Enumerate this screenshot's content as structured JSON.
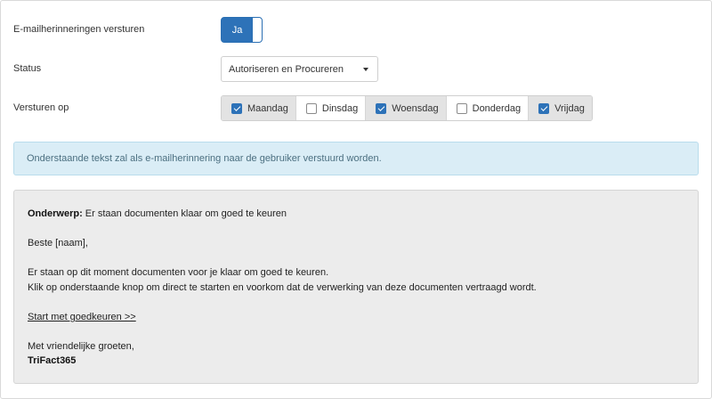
{
  "settings": {
    "reminders_label": "E-mailherinneringen versturen",
    "toggle_value": "Ja",
    "status_label": "Status",
    "status_selected": "Autoriseren en Procureren",
    "send_on_label": "Versturen op",
    "days": [
      {
        "label": "Maandag",
        "checked": true
      },
      {
        "label": "Dinsdag",
        "checked": false
      },
      {
        "label": "Woensdag",
        "checked": true
      },
      {
        "label": "Donderdag",
        "checked": false
      },
      {
        "label": "Vrijdag",
        "checked": true
      }
    ]
  },
  "info": {
    "text": "Onderstaande tekst zal als e-mailherinnering naar de gebruiker verstuurd worden."
  },
  "email": {
    "subject_label": "Onderwerp:",
    "subject": "Er staan documenten klaar om goed te keuren",
    "greeting": "Beste [naam],",
    "body_line1": "Er staan op dit moment documenten voor je klaar om goed te keuren.",
    "body_line2": "Klik op onderstaande knop om direct te starten en voorkom dat de verwerking van deze documenten vertraagd wordt.",
    "link": "Start met goedkeuren >>",
    "closing": "Met vriendelijke groeten,",
    "signature": "TriFact365"
  },
  "colors": {
    "primary": "#2d72b8",
    "info_bg": "#daedf6",
    "preview_bg": "#ececec"
  }
}
